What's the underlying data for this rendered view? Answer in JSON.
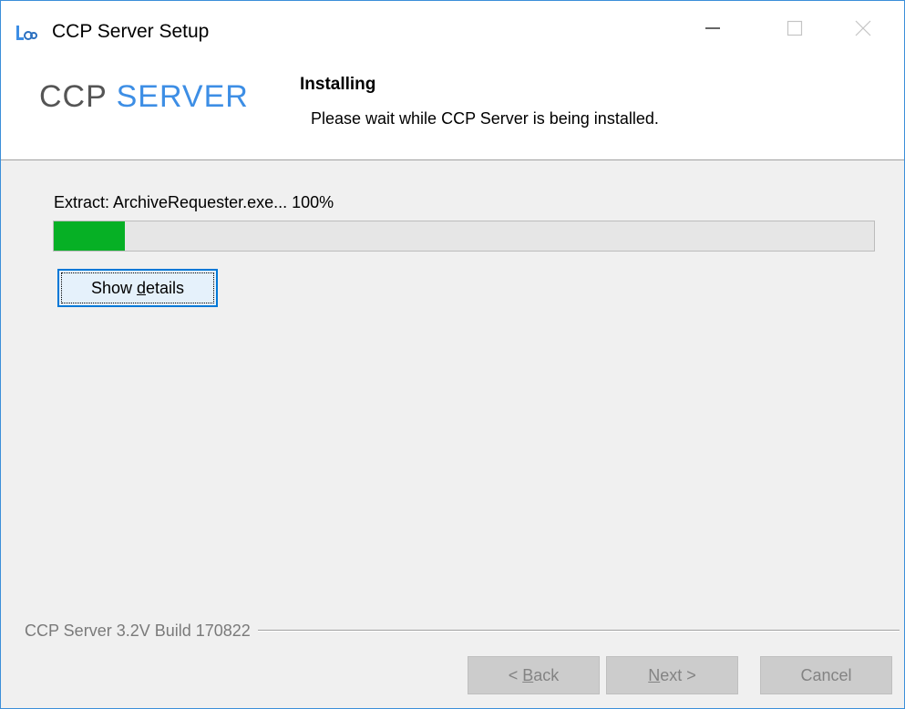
{
  "window": {
    "title": "CCP Server Setup",
    "icon": "ccp-app-icon"
  },
  "header": {
    "logo_ccp": "CCP",
    "logo_server": "SERVER",
    "title": "Installing",
    "subtitle": "Please wait while CCP Server is being installed."
  },
  "progress": {
    "status_text": "Extract: ArchiveRequester.exe... 100%",
    "fill_fraction": 0.087,
    "fill_color": "#06b025"
  },
  "buttons": {
    "show_details_prefix": "Show ",
    "show_details_accel": "d",
    "show_details_suffix": "etails",
    "back_prefix": "< ",
    "back_accel": "B",
    "back_suffix": "ack",
    "next_accel": "N",
    "next_suffix": "ext >",
    "cancel": "Cancel"
  },
  "footer": {
    "version": "CCP Server 3.2V Build 170822"
  },
  "colors": {
    "accent": "#0078d7",
    "logo_blue": "#3d8ee5",
    "window_border": "#3c8fd9"
  }
}
